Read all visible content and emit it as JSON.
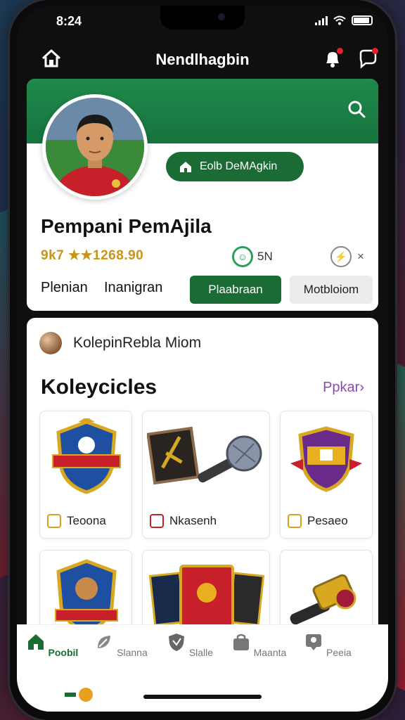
{
  "status_bar": {
    "time": "8:24"
  },
  "header": {
    "title": "Nendlhagbin"
  },
  "profile": {
    "follow_label": "Eolb DeMAgkin",
    "name": "Pempani PemAjila",
    "stats": "9k7 ★★1268.90",
    "badge_1_icon": "☺",
    "badge_1_label": "5N",
    "badge_2_icon": "⚡",
    "badge_2_label": "×",
    "tabs": [
      {
        "label": "Plenian"
      },
      {
        "label": "Inanigran"
      }
    ],
    "primary_button": "Plaabraan",
    "secondary_button": "Motbloiom"
  },
  "collection": {
    "header_label": "KolepinRebla Miom",
    "title": "Koleycicles",
    "link_label": "Ppkar›",
    "items": [
      {
        "label": "Teoona",
        "icon": "shield-crest-icon"
      },
      {
        "label": "Nkasenh",
        "icon": "hammer-flag-icon"
      },
      {
        "label": "Pesaeo",
        "icon": "crest-badge-icon"
      },
      {
        "icon": "shield-ball-icon"
      },
      {
        "icon": "card-deck-icon"
      },
      {
        "icon": "golden-hammer-icon"
      }
    ]
  },
  "bottom_nav": [
    {
      "label": "Poobil",
      "icon": "home-icon",
      "active": true
    },
    {
      "label": "Slanna",
      "icon": "leaf-icon",
      "active": false
    },
    {
      "label": "Slalle",
      "icon": "shield-icon",
      "active": false
    },
    {
      "label": "Maanta",
      "icon": "bag-icon",
      "active": false
    },
    {
      "label": "Peeia",
      "icon": "profile-icon",
      "active": false
    }
  ],
  "colors": {
    "brand_green": "#1b6b35",
    "banner_green": "#1f8a4c",
    "gold": "#c8941a",
    "link_purple": "#8a4ab0"
  }
}
